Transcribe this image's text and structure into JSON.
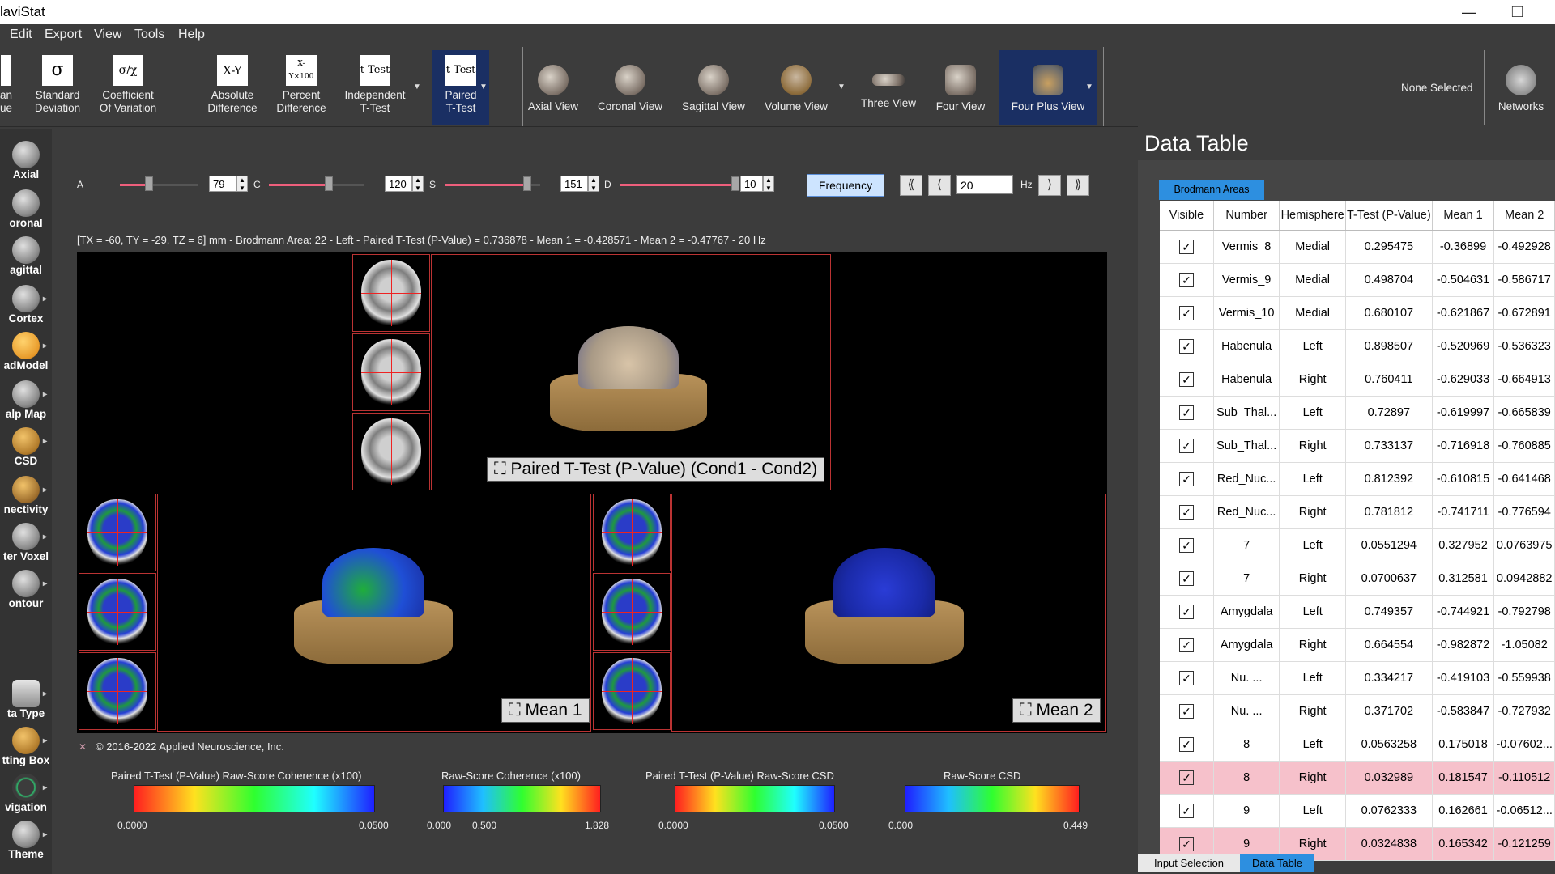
{
  "app": {
    "title": "laviStat",
    "minimize": "—",
    "restore": "❐"
  },
  "menu": [
    "Edit",
    "Export",
    "View",
    "Tools",
    "Help"
  ],
  "ribbon": {
    "partial_left": {
      "line1": "an",
      "line2": "ue"
    },
    "stats": [
      {
        "label1": "Standard",
        "label2": "Deviation",
        "symbol": "σ"
      },
      {
        "label1": "Coefficient",
        "label2": "Of Variation",
        "symbol": "σ/χ"
      },
      {
        "label1": "Absolute",
        "label2": "Difference",
        "symbol": "X-Y"
      },
      {
        "label1": "Percent",
        "label2": "Difference",
        "symbol": "X-Y×100"
      },
      {
        "label1": "Independent",
        "label2": "T-Test",
        "symbol": "t Test"
      },
      {
        "label1": "Paired",
        "label2": "T-Test",
        "symbol": "t Test"
      }
    ],
    "views": [
      "Axial View",
      "Coronal View",
      "Sagittal View",
      "Volume View",
      "Three View",
      "Four View",
      "Four Plus View"
    ],
    "none_selected": "None Selected",
    "networks": "Networks"
  },
  "sidebar": [
    "Axial",
    "oronal",
    "agittal",
    "Cortex",
    "adModel",
    "alp Map",
    "CSD",
    "nectivity",
    "ter Voxel",
    "ontour",
    "ta Type",
    "tting Box",
    "vigation",
    "Theme"
  ],
  "sliders": [
    {
      "label": "A",
      "value": "79",
      "fraction": 0.36
    },
    {
      "label": "C",
      "value": "120",
      "fraction": 0.62
    },
    {
      "label": "S",
      "value": "151",
      "fraction": 0.86
    },
    {
      "label": "D",
      "value": "10",
      "fraction": 1.0
    }
  ],
  "frequency": {
    "button": "Frequency",
    "value": "20",
    "unit": "Hz",
    "first": "⟪",
    "prev": "⟨",
    "next": "⟩",
    "last": "⟫"
  },
  "status_line": "[TX = -60, TY = -29, TZ = 6] mm - Brodmann Area: 22 - Left - Paired T-Test (P-Value) = 0.736878 - Mean 1 = -0.428571 - Mean 2 = -0.47767 - 20 Hz",
  "panels": {
    "main": "Paired T-Test (P-Value) (Cond1 - Cond2)",
    "mean1": "Mean 1",
    "mean2": "Mean 2",
    "expand_icon": "⛶"
  },
  "copyright": "© 2016-2022 Applied Neuroscience, Inc.",
  "colorbars": [
    {
      "title": "Paired T-Test (P-Value) Raw-Score Coherence (x100)",
      "min": "0.0000",
      "max": "0.0500",
      "mid": "",
      "colors": [
        "#ff1f1f",
        "#ffe11f",
        "#2fff2f",
        "#1fffff",
        "#1f1fff"
      ]
    },
    {
      "title": "Raw-Score Coherence (x100)",
      "min": "0.000",
      "mid": "0.500",
      "max": "1.828",
      "colors": [
        "#1f1fff",
        "#1fbfff",
        "#2fff2f",
        "#ffe11f",
        "#ff1f1f"
      ]
    },
    {
      "title": "Paired T-Test (P-Value) Raw-Score CSD",
      "min": "0.0000",
      "max": "0.0500",
      "mid": "",
      "colors": [
        "#ff1f1f",
        "#ffe11f",
        "#2fff2f",
        "#1fffff",
        "#1f1fff"
      ]
    },
    {
      "title": "Raw-Score CSD",
      "min": "0.000",
      "max": "0.449",
      "mid": "",
      "colors": [
        "#1f1fff",
        "#1fbfff",
        "#2fff2f",
        "#ffe11f",
        "#ff1f1f"
      ]
    }
  ],
  "data_table": {
    "title": "Data Table",
    "tab": "Brodmann Areas",
    "columns": [
      "Visible",
      "Number",
      "Hemisphere",
      "T-Test (P-Value)",
      "Mean 1",
      "Mean 2"
    ],
    "rows": [
      {
        "number": "Vermis_8",
        "hemi": "Medial",
        "t": "0.295475",
        "m1": "-0.36899",
        "m2": "-0.492928",
        "hl": false
      },
      {
        "number": "Vermis_9",
        "hemi": "Medial",
        "t": "0.498704",
        "m1": "-0.504631",
        "m2": "-0.586717",
        "hl": false
      },
      {
        "number": "Vermis_10",
        "hemi": "Medial",
        "t": "0.680107",
        "m1": "-0.621867",
        "m2": "-0.672891",
        "hl": false
      },
      {
        "number": "Habenula",
        "hemi": "Left",
        "t": "0.898507",
        "m1": "-0.520969",
        "m2": "-0.536323",
        "hl": false
      },
      {
        "number": "Habenula",
        "hemi": "Right",
        "t": "0.760411",
        "m1": "-0.629033",
        "m2": "-0.664913",
        "hl": false
      },
      {
        "number": "Sub_Thal...",
        "hemi": "Left",
        "t": "0.72897",
        "m1": "-0.619997",
        "m2": "-0.665839",
        "hl": false
      },
      {
        "number": "Sub_Thal...",
        "hemi": "Right",
        "t": "0.733137",
        "m1": "-0.716918",
        "m2": "-0.760885",
        "hl": false
      },
      {
        "number": "Red_Nuc...",
        "hemi": "Left",
        "t": "0.812392",
        "m1": "-0.610815",
        "m2": "-0.641468",
        "hl": false
      },
      {
        "number": "Red_Nuc...",
        "hemi": "Right",
        "t": "0.781812",
        "m1": "-0.741711",
        "m2": "-0.776594",
        "hl": false
      },
      {
        "number": "7",
        "hemi": "Left",
        "t": "0.0551294",
        "m1": "0.327952",
        "m2": "0.0763975",
        "hl": false
      },
      {
        "number": "7",
        "hemi": "Right",
        "t": "0.0700637",
        "m1": "0.312581",
        "m2": "0.0942882",
        "hl": false
      },
      {
        "number": "Amygdala",
        "hemi": "Left",
        "t": "0.749357",
        "m1": "-0.744921",
        "m2": "-0.792798",
        "hl": false
      },
      {
        "number": "Amygdala",
        "hemi": "Right",
        "t": "0.664554",
        "m1": "-0.982872",
        "m2": "-1.05082",
        "hl": false
      },
      {
        "number": "Nu. ...",
        "hemi": "Left",
        "t": "0.334217",
        "m1": "-0.419103",
        "m2": "-0.559938",
        "hl": false
      },
      {
        "number": "Nu. ...",
        "hemi": "Right",
        "t": "0.371702",
        "m1": "-0.583847",
        "m2": "-0.727932",
        "hl": false
      },
      {
        "number": "8",
        "hemi": "Left",
        "t": "0.0563258",
        "m1": "0.175018",
        "m2": "-0.07602...",
        "hl": false
      },
      {
        "number": "8",
        "hemi": "Right",
        "t": "0.032989",
        "m1": "0.181547",
        "m2": "-0.110512",
        "hl": true
      },
      {
        "number": "9",
        "hemi": "Left",
        "t": "0.0762333",
        "m1": "0.162661",
        "m2": "-0.06512...",
        "hl": false
      },
      {
        "number": "9",
        "hemi": "Right",
        "t": "0.0324838",
        "m1": "0.165342",
        "m2": "-0.121259",
        "hl": true
      }
    ],
    "check": "✓"
  },
  "bottom_tabs": {
    "input": "Input Selection",
    "table": "Data Table"
  }
}
